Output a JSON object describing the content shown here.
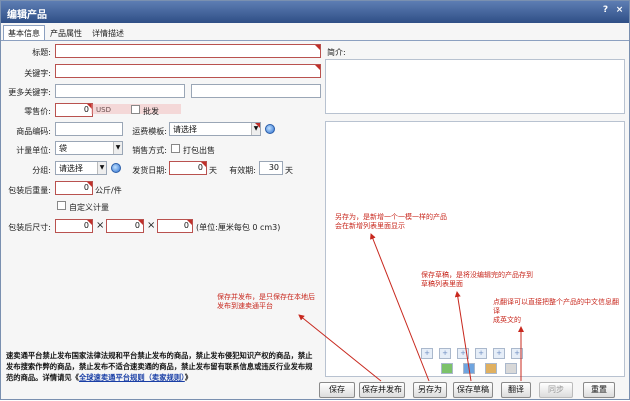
{
  "window": {
    "title": "编辑产品",
    "help_glyph": "?",
    "close_glyph": "×"
  },
  "tabs": [
    "基本信息",
    "产品属性",
    "详情描述"
  ],
  "fields": {
    "title_label": "标题:",
    "intro_label": "简介:",
    "keyword_label": "关键字:",
    "more_keywords_label": "更多关键字:",
    "price_label": "零售价:",
    "price_value": "0",
    "price_unit": "USD",
    "wholesale_label": "批发",
    "sku_label": "商品编码:",
    "shipping_label": "运费模板:",
    "shipping_value": "请选择",
    "unit_label": "计量单位:",
    "unit_value": "袋",
    "sale_method_label": "销售方式:",
    "pack_sale_label": "打包出售",
    "group_label": "分组:",
    "group_value": "请选择",
    "delivery_label": "发货日期:",
    "delivery_value": "0",
    "delivery_unit": "天",
    "validity_label": "有效期:",
    "validity_value": "30",
    "validity_unit": "天",
    "weight_label": "包装后重量:",
    "weight_value": "0",
    "weight_unit": "公斤/件",
    "custom_measure_label": "自定义计量",
    "size_label": "包装后尺寸:",
    "size_l": "0",
    "size_w": "0",
    "size_h": "0",
    "times_glyph": "×",
    "size_unit": "(单位:厘米每包 0 cm3)"
  },
  "notice": {
    "text": "速卖通平台禁止发布国家法律法规和平台禁止发布的商品，禁止发布侵犯知识产权的商品，禁止发布搜索作弊的商品，禁止发布不适合速卖通的商品，禁止发布留有联系信息或违反行业发布规范的商品。详情请见《",
    "link_text": "全球速卖通平台规则（卖家规则）",
    "tail": "》"
  },
  "buttons": [
    "保存",
    "保存并发布",
    "另存为",
    "保存草稿",
    "翻译",
    "同步",
    "重置"
  ],
  "annotations": {
    "save_as": [
      "另存为，是新增一个一模一样的产品",
      "会在新增列表里面显示"
    ],
    "save_draft": [
      "保存草稿，是将没编辑完的产品存到",
      "草稿列表里面"
    ],
    "save_publish": [
      "保存并发布，是只保存在本地后",
      "发布到速卖通平台"
    ],
    "translate": [
      "点翻译可以直接把整个产品的中文信息翻",
      "译",
      "成英文的"
    ]
  },
  "colors": {
    "annotation": "#c8281e",
    "titlebar": "#3d5f97",
    "required": "#c0302a"
  }
}
